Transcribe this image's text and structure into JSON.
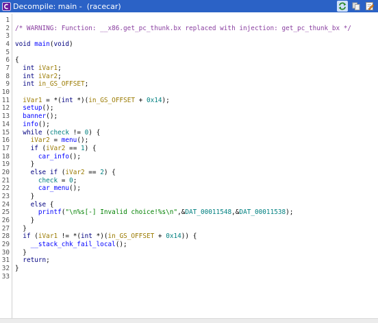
{
  "window": {
    "title": "Decompile: main -  (racecar)",
    "colors": {
      "titlebar": "#2b62c6",
      "comment": "#8a3fa0",
      "type": "#000080",
      "function": "#0000ff",
      "variable": "#9a7a00",
      "number": "#008080",
      "string": "#008000"
    }
  },
  "toolbar": {
    "icons": [
      "refresh-icon",
      "copy-icon",
      "edit-icon"
    ]
  },
  "lines": [
    {
      "n": "1",
      "tokens": []
    },
    {
      "n": "2",
      "tokens": [
        {
          "c": "comment",
          "t": "/* WARNING: Function: __x86.get_pc_thunk.bx replaced with injection: get_pc_thunk_bx */"
        }
      ]
    },
    {
      "n": "3",
      "tokens": []
    },
    {
      "n": "4",
      "tokens": [
        {
          "c": "t",
          "t": "void"
        },
        {
          "c": "p",
          "t": " "
        },
        {
          "c": "fn",
          "t": "main"
        },
        {
          "c": "p",
          "t": "("
        },
        {
          "c": "t",
          "t": "void"
        },
        {
          "c": "p",
          "t": ")"
        }
      ]
    },
    {
      "n": "5",
      "tokens": []
    },
    {
      "n": "6",
      "tokens": [
        {
          "c": "p",
          "t": "{"
        }
      ]
    },
    {
      "n": "7",
      "tokens": [
        {
          "c": "p",
          "t": "  "
        },
        {
          "c": "t",
          "t": "int"
        },
        {
          "c": "p",
          "t": " "
        },
        {
          "c": "var",
          "t": "iVar1"
        },
        {
          "c": "p",
          "t": ";"
        }
      ]
    },
    {
      "n": "8",
      "tokens": [
        {
          "c": "p",
          "t": "  "
        },
        {
          "c": "t",
          "t": "int"
        },
        {
          "c": "p",
          "t": " "
        },
        {
          "c": "var",
          "t": "iVar2"
        },
        {
          "c": "p",
          "t": ";"
        }
      ]
    },
    {
      "n": "9",
      "tokens": [
        {
          "c": "p",
          "t": "  "
        },
        {
          "c": "t",
          "t": "int"
        },
        {
          "c": "p",
          "t": " "
        },
        {
          "c": "var",
          "t": "in_GS_OFFSET"
        },
        {
          "c": "p",
          "t": ";"
        }
      ]
    },
    {
      "n": "10",
      "tokens": []
    },
    {
      "n": "11",
      "tokens": [
        {
          "c": "p",
          "t": "  "
        },
        {
          "c": "var",
          "t": "iVar1"
        },
        {
          "c": "p",
          "t": " = *("
        },
        {
          "c": "t",
          "t": "int"
        },
        {
          "c": "p",
          "t": " *)("
        },
        {
          "c": "var",
          "t": "in_GS_OFFSET"
        },
        {
          "c": "p",
          "t": " + "
        },
        {
          "c": "num",
          "t": "0x14"
        },
        {
          "c": "p",
          "t": ");"
        }
      ]
    },
    {
      "n": "12",
      "tokens": [
        {
          "c": "p",
          "t": "  "
        },
        {
          "c": "fn",
          "t": "setup"
        },
        {
          "c": "p",
          "t": "();"
        }
      ]
    },
    {
      "n": "13",
      "tokens": [
        {
          "c": "p",
          "t": "  "
        },
        {
          "c": "fn",
          "t": "banner"
        },
        {
          "c": "p",
          "t": "();"
        }
      ]
    },
    {
      "n": "14",
      "tokens": [
        {
          "c": "p",
          "t": "  "
        },
        {
          "c": "fn",
          "t": "info"
        },
        {
          "c": "p",
          "t": "();"
        }
      ]
    },
    {
      "n": "15",
      "tokens": [
        {
          "c": "p",
          "t": "  "
        },
        {
          "c": "t",
          "t": "while"
        },
        {
          "c": "p",
          "t": " ("
        },
        {
          "c": "glob",
          "t": "check"
        },
        {
          "c": "p",
          "t": " != "
        },
        {
          "c": "num",
          "t": "0"
        },
        {
          "c": "p",
          "t": ") {"
        }
      ]
    },
    {
      "n": "16",
      "tokens": [
        {
          "c": "p",
          "t": "    "
        },
        {
          "c": "var",
          "t": "iVar2"
        },
        {
          "c": "p",
          "t": " = "
        },
        {
          "c": "fn",
          "t": "menu"
        },
        {
          "c": "p",
          "t": "();"
        }
      ]
    },
    {
      "n": "17",
      "tokens": [
        {
          "c": "p",
          "t": "    "
        },
        {
          "c": "t",
          "t": "if"
        },
        {
          "c": "p",
          "t": " ("
        },
        {
          "c": "var",
          "t": "iVar2"
        },
        {
          "c": "p",
          "t": " == "
        },
        {
          "c": "num",
          "t": "1"
        },
        {
          "c": "p",
          "t": ") {"
        }
      ]
    },
    {
      "n": "18",
      "tokens": [
        {
          "c": "p",
          "t": "      "
        },
        {
          "c": "fn",
          "t": "car_info"
        },
        {
          "c": "p",
          "t": "();"
        }
      ]
    },
    {
      "n": "19",
      "tokens": [
        {
          "c": "p",
          "t": "    }"
        }
      ]
    },
    {
      "n": "20",
      "tokens": [
        {
          "c": "p",
          "t": "    "
        },
        {
          "c": "t",
          "t": "else"
        },
        {
          "c": "p",
          "t": " "
        },
        {
          "c": "t",
          "t": "if"
        },
        {
          "c": "p",
          "t": " ("
        },
        {
          "c": "var",
          "t": "iVar2"
        },
        {
          "c": "p",
          "t": " == "
        },
        {
          "c": "num",
          "t": "2"
        },
        {
          "c": "p",
          "t": ") {"
        }
      ]
    },
    {
      "n": "21",
      "tokens": [
        {
          "c": "p",
          "t": "      "
        },
        {
          "c": "glob",
          "t": "check"
        },
        {
          "c": "p",
          "t": " = "
        },
        {
          "c": "num",
          "t": "0"
        },
        {
          "c": "p",
          "t": ";"
        }
      ]
    },
    {
      "n": "22",
      "tokens": [
        {
          "c": "p",
          "t": "      "
        },
        {
          "c": "fn",
          "t": "car_menu"
        },
        {
          "c": "p",
          "t": "();"
        }
      ]
    },
    {
      "n": "23",
      "tokens": [
        {
          "c": "p",
          "t": "    }"
        }
      ]
    },
    {
      "n": "24",
      "tokens": [
        {
          "c": "p",
          "t": "    "
        },
        {
          "c": "t",
          "t": "else"
        },
        {
          "c": "p",
          "t": " {"
        }
      ]
    },
    {
      "n": "25",
      "tokens": [
        {
          "c": "p",
          "t": "      "
        },
        {
          "c": "fn",
          "t": "printf"
        },
        {
          "c": "p",
          "t": "("
        },
        {
          "c": "str",
          "t": "\"\\n%s[-] Invalid choice!%s\\n\""
        },
        {
          "c": "p",
          "t": ",&"
        },
        {
          "c": "glob",
          "t": "DAT_00011548"
        },
        {
          "c": "p",
          "t": ",&"
        },
        {
          "c": "glob",
          "t": "DAT_00011538"
        },
        {
          "c": "p",
          "t": ");"
        }
      ]
    },
    {
      "n": "26",
      "tokens": [
        {
          "c": "p",
          "t": "    }"
        }
      ]
    },
    {
      "n": "27",
      "tokens": [
        {
          "c": "p",
          "t": "  }"
        }
      ]
    },
    {
      "n": "28",
      "tokens": [
        {
          "c": "p",
          "t": "  "
        },
        {
          "c": "t",
          "t": "if"
        },
        {
          "c": "p",
          "t": " ("
        },
        {
          "c": "var",
          "t": "iVar1"
        },
        {
          "c": "p",
          "t": " != *("
        },
        {
          "c": "t",
          "t": "int"
        },
        {
          "c": "p",
          "t": " *)("
        },
        {
          "c": "var",
          "t": "in_GS_OFFSET"
        },
        {
          "c": "p",
          "t": " + "
        },
        {
          "c": "num",
          "t": "0x14"
        },
        {
          "c": "p",
          "t": ")) {"
        }
      ]
    },
    {
      "n": "29",
      "tokens": [
        {
          "c": "p",
          "t": "    "
        },
        {
          "c": "fn",
          "t": "__stack_chk_fail_local"
        },
        {
          "c": "p",
          "t": "();"
        }
      ]
    },
    {
      "n": "30",
      "tokens": [
        {
          "c": "p",
          "t": "  }"
        }
      ]
    },
    {
      "n": "31",
      "tokens": [
        {
          "c": "p",
          "t": "  "
        },
        {
          "c": "t",
          "t": "return"
        },
        {
          "c": "p",
          "t": ";"
        }
      ]
    },
    {
      "n": "32",
      "tokens": [
        {
          "c": "p",
          "t": "}"
        }
      ]
    },
    {
      "n": "33",
      "tokens": []
    }
  ]
}
